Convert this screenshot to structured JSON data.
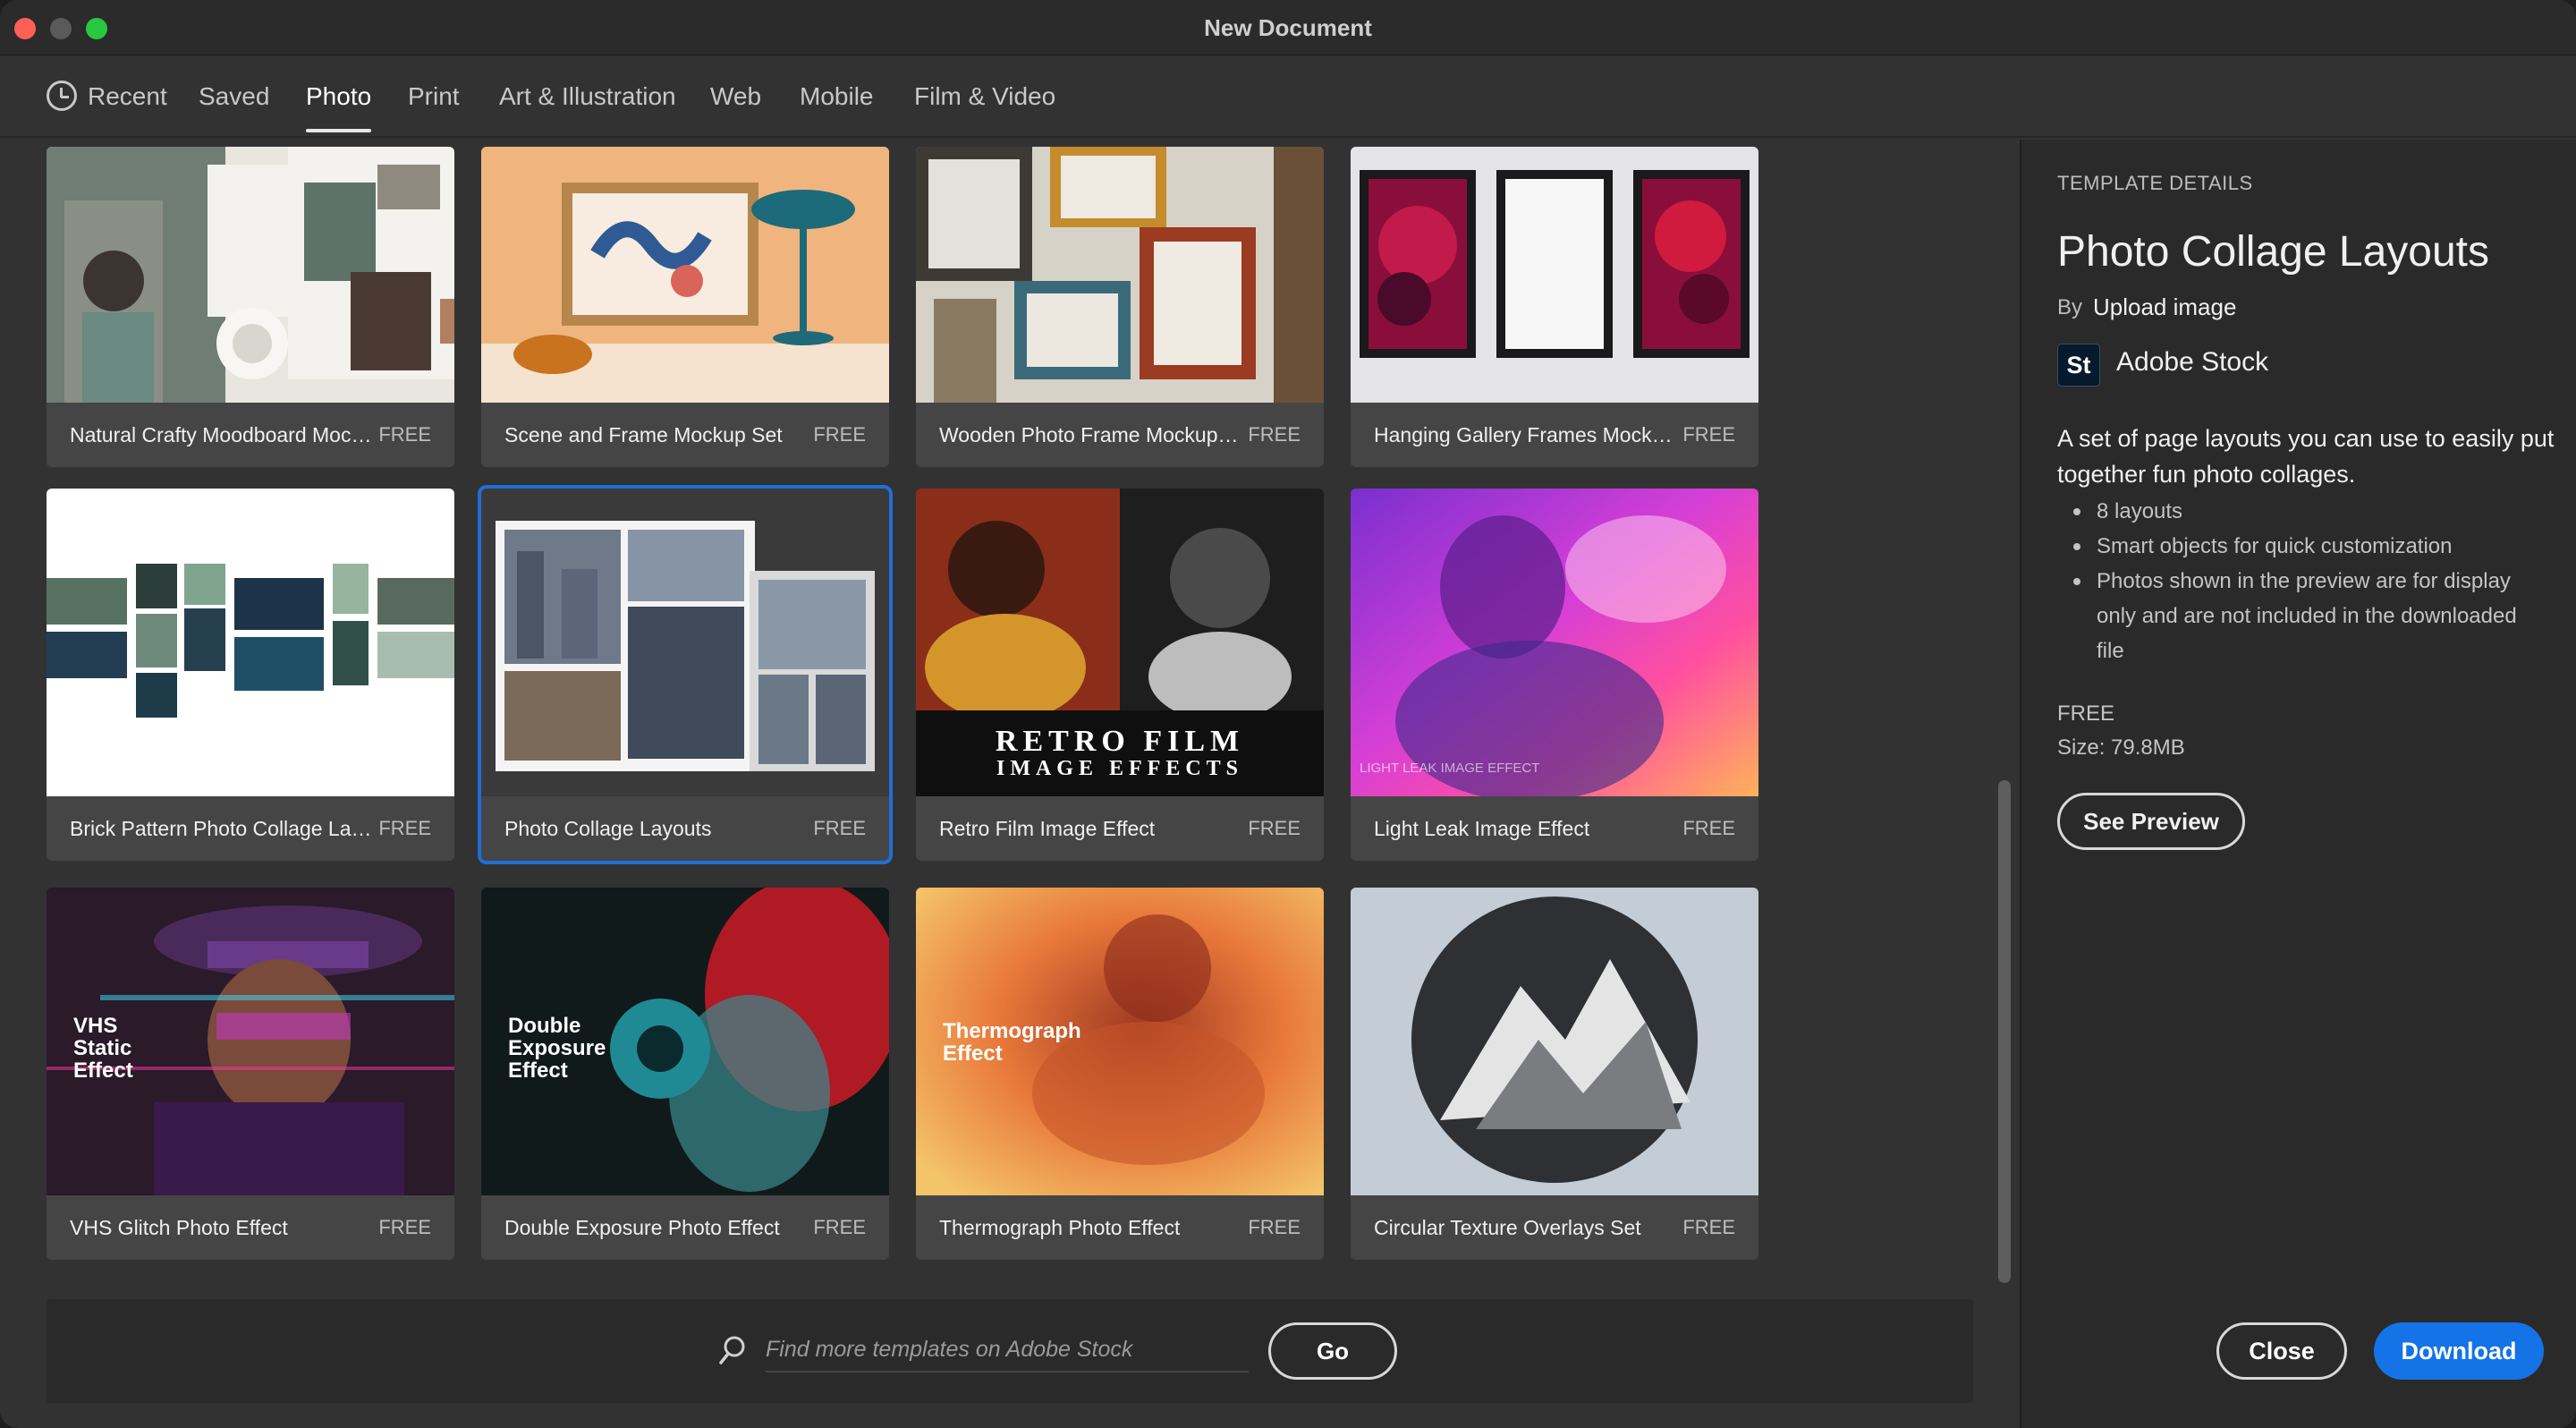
{
  "window": {
    "title": "New Document"
  },
  "tabs": [
    {
      "label": "Recent"
    },
    {
      "label": "Saved"
    },
    {
      "label": "Photo"
    },
    {
      "label": "Print"
    },
    {
      "label": "Art & Illustration"
    },
    {
      "label": "Web"
    },
    {
      "label": "Mobile"
    },
    {
      "label": "Film & Video"
    }
  ],
  "active_tab": "Photo",
  "templates": [
    {
      "name": "Natural Crafty Moodboard Mockup",
      "price": "FREE"
    },
    {
      "name": "Scene and Frame Mockup Set",
      "price": "FREE"
    },
    {
      "name": "Wooden Photo Frame Mockup Set",
      "price": "FREE"
    },
    {
      "name": "Hanging Gallery Frames Mockups",
      "price": "FREE"
    },
    {
      "name": "Brick Pattern Photo Collage Layo...",
      "price": "FREE"
    },
    {
      "name": "Photo Collage Layouts",
      "price": "FREE",
      "selected": true
    },
    {
      "name": "Retro Film Image Effect",
      "price": "FREE",
      "thumb_text": [
        "RETRO FILM",
        "IMAGE EFFECTS"
      ]
    },
    {
      "name": "Light Leak Image Effect",
      "price": "FREE",
      "thumb_text": [
        "LIGHT LEAK IMAGE EFFECT"
      ]
    },
    {
      "name": "VHS Glitch Photo Effect",
      "price": "FREE",
      "thumb_text": [
        "VHS",
        "Static",
        "Effect"
      ]
    },
    {
      "name": "Double Exposure Photo Effect",
      "price": "FREE",
      "thumb_text": [
        "Double",
        "Exposure",
        "Effect"
      ]
    },
    {
      "name": "Thermograph Photo Effect",
      "price": "FREE",
      "thumb_text": [
        "Thermograph",
        "Effect"
      ]
    },
    {
      "name": "Circular Texture Overlays Set",
      "price": "FREE"
    }
  ],
  "search": {
    "placeholder": "Find more templates on Adobe Stock",
    "go_label": "Go",
    "icon": "search-icon"
  },
  "details": {
    "heading": "TEMPLATE DETAILS",
    "title": "Photo Collage Layouts",
    "by_label": "By",
    "author": "Upload image",
    "source_logo": "St",
    "source_name": "Adobe Stock",
    "description": "A set of page layouts you can use to easily put together fun photo collages.",
    "bullets": [
      "8 layouts",
      "Smart objects for quick customization",
      "Photos shown in the preview are for display only and are not included in the downloaded file"
    ],
    "price": "FREE",
    "size_label": "Size:",
    "size": "79.8MB",
    "see_preview_label": "See Preview"
  },
  "footer": {
    "close_label": "Close",
    "download_label": "Download"
  },
  "colors": {
    "accent": "#1473e6",
    "selection": "#3b8ff6",
    "background": "#323232",
    "panel": "#2a2a2a"
  }
}
